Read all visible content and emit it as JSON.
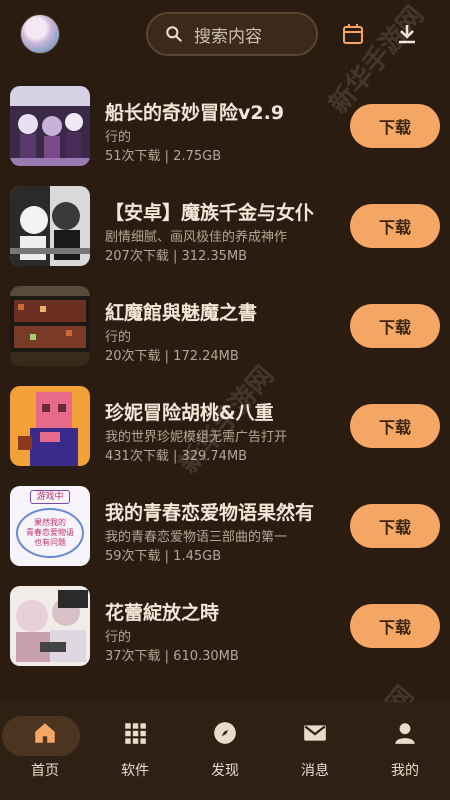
{
  "header": {
    "search_placeholder": "搜索内容",
    "icons": [
      "avatar",
      "search-icon",
      "calendar-icon",
      "download-icon"
    ]
  },
  "items": [
    {
      "title": "船长的奇妙冒险v2.9",
      "desc": "行的",
      "meta": "51次下载 | 2.75GB",
      "button": "下载"
    },
    {
      "title": "【安卓】魔族千金与女仆",
      "desc": "剧情细腻、画风极佳的养成神作",
      "meta": "207次下载 | 312.35MB",
      "button": "下载"
    },
    {
      "title": "紅魔館與魅魔之書",
      "desc": "行的",
      "meta": "20次下载 | 172.24MB",
      "button": "下载"
    },
    {
      "title": "珍妮冒险胡桃&八重",
      "desc": "我的世界珍妮模组无需广告打开",
      "meta": "431次下载 | 329.74MB",
      "button": "下载"
    },
    {
      "title": "我的青春恋爱物语果然有",
      "desc": "我的青春恋爱物语三部曲的第一",
      "meta": "59次下载 | 1.45GB",
      "button": "下载"
    },
    {
      "title": "花蕾綻放之時",
      "desc": "行的",
      "meta": "37次下载 | 610.30MB",
      "button": "下载"
    }
  ],
  "thumb4_text": [
    "游戏中",
    "果然我的",
    "青春恋爱物语",
    "也有问题"
  ],
  "watermark": "新华手游网",
  "nav": [
    {
      "label": "首页",
      "icon": "home-icon",
      "active": true
    },
    {
      "label": "软件",
      "icon": "grid-icon",
      "active": false
    },
    {
      "label": "发现",
      "icon": "compass-icon",
      "active": false
    },
    {
      "label": "消息",
      "icon": "mail-icon",
      "active": false
    },
    {
      "label": "我的",
      "icon": "user-icon",
      "active": false
    }
  ],
  "colors": {
    "background": "#2a1c10",
    "accent": "#f4a764",
    "nav": "#2f2014"
  }
}
